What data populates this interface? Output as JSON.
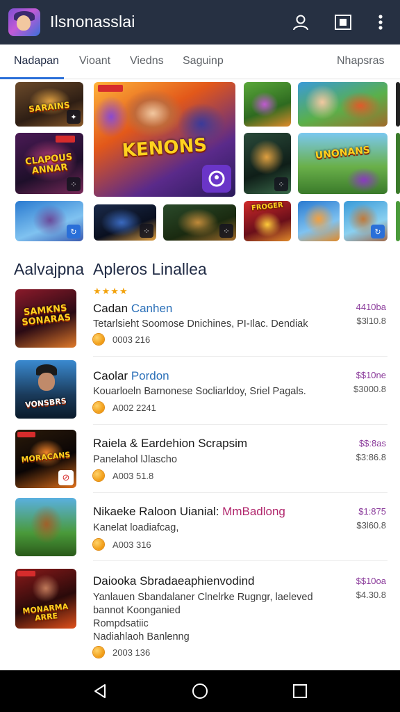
{
  "app_bar": {
    "title": "Ilsnonasslai",
    "background": "#263042",
    "icons": [
      "account-icon",
      "media-icon",
      "more-vert-icon"
    ]
  },
  "tabs": [
    {
      "label": "Nadapan",
      "active": true
    },
    {
      "label": "Vioant",
      "active": false
    },
    {
      "label": "Viedns",
      "active": false
    },
    {
      "label": "Saguinp",
      "active": false
    },
    {
      "label": "Nhapsras",
      "active": false
    }
  ],
  "featured": {
    "big_tile_title": "KENONS",
    "tiles": [
      {
        "title": "SARAINS"
      },
      {
        "title": "CLAPOUS ANNAR"
      },
      {
        "title": ""
      },
      {
        "title": ""
      },
      {
        "title": ""
      },
      {
        "title": ""
      },
      {
        "title": "UNONANS"
      },
      {
        "title": ""
      },
      {
        "title": ""
      },
      {
        "title": ""
      },
      {
        "title": "FROGER"
      },
      {
        "title": ""
      },
      {
        "title": ""
      }
    ]
  },
  "section": {
    "left_title": "Aalvajpna",
    "right_title": "Apleros Linallea",
    "stars": "★★★★"
  },
  "apps": [
    {
      "thumb_title": "SAMKNS SONARAS",
      "title_main": "Cadan ",
      "title_highlight": "Canhen",
      "highlight_color": "blue",
      "description": "Tetarlsieht Soomose Dnichines, PI-Ilac. Dendiak",
      "meta": "0003 216",
      "price_top": "4410ba",
      "price_bottom": "$3l10.8"
    },
    {
      "thumb_title": "VONSBRS",
      "title_main": "Caolar ",
      "title_highlight": "Pordon",
      "highlight_color": "blue",
      "description": "Kouarloeln Barnonese Socliarldoy, Sriel Pagals.",
      "meta": "A002 2241",
      "price_top": "$$10ne",
      "price_bottom": "$3000.8"
    },
    {
      "thumb_title": "MORACANS",
      "title_main": "Raiela & Eardehion Scrapsim",
      "title_highlight": "",
      "highlight_color": "",
      "description": "Panelahol lJlascho",
      "meta": "A003 51.8",
      "price_top": "$$:8as",
      "price_bottom": "$3:86.8"
    },
    {
      "thumb_title": "",
      "title_main": "Nikaeke Raloon Uianial: ",
      "title_highlight": "MmBadlong",
      "highlight_color": "pink",
      "description": "Kanelat loadiafcag,",
      "meta": "A003 316",
      "price_top": "$1:875",
      "price_bottom": "$3l60.8"
    },
    {
      "thumb_title": "MONARMA ARRE",
      "title_main": "Daiooka Sbradaeaphienvodind",
      "title_highlight": "",
      "highlight_color": "",
      "description": "Yanlauen Sbandalaner Clnelrke Rugngr, laeleved",
      "description2": "bannot Koonganied",
      "description3": "Rompdsatiic",
      "description4": "Nadiahlaoh Banlenng",
      "meta": "2003 136",
      "price_top": "$$10oa",
      "price_bottom": "$4.30.8"
    }
  ],
  "nav": [
    "back-icon",
    "home-icon",
    "recents-icon"
  ]
}
